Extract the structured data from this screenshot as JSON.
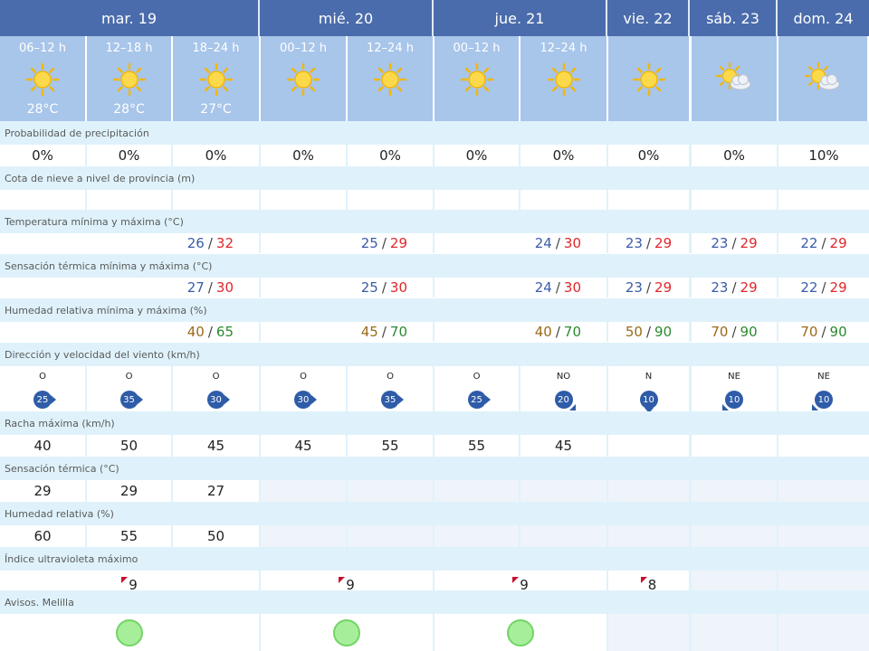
{
  "days": [
    {
      "label": "mar. 19"
    },
    {
      "label": "mié. 20"
    },
    {
      "label": "jue. 21"
    },
    {
      "label": "vie. 22"
    },
    {
      "label": "sáb. 23"
    },
    {
      "label": "dom. 24"
    }
  ],
  "periods": [
    {
      "label": "06–12 h",
      "temp": "28°C",
      "icon": "sun-icon"
    },
    {
      "label": "12–18 h",
      "temp": "28°C",
      "icon": "sun-icon"
    },
    {
      "label": "18–24 h",
      "temp": "27°C",
      "icon": "sun-icon"
    },
    {
      "label": "00–12 h",
      "temp": "",
      "icon": "sun-icon"
    },
    {
      "label": "12–24 h",
      "temp": "",
      "icon": "sun-icon"
    },
    {
      "label": "00–12 h",
      "temp": "",
      "icon": "sun-icon"
    },
    {
      "label": "12–24 h",
      "temp": "",
      "icon": "sun-icon"
    },
    {
      "label": "",
      "temp": "",
      "icon": "sun-icon"
    },
    {
      "label": "",
      "temp": "",
      "icon": "sun-cloud-icon"
    },
    {
      "label": "",
      "temp": "",
      "icon": "sun-cloud-icon"
    }
  ],
  "labels": {
    "precip": "Probabilidad de precipitación",
    "snow": "Cota de nieve a nivel de provincia (m)",
    "temp": "Temperatura mínima y máxima (°C)",
    "feels": "Sensación térmica mínima y máxima (°C)",
    "humidity": "Humedad relativa mínima y máxima (%)",
    "wind": "Dirección y velocidad del viento (km/h)",
    "gust": "Racha máxima (km/h)",
    "feels_now": "Sensación térmica (°C)",
    "humidity_now": "Humedad relativa (%)",
    "uv": "Índice ultravioleta máximo",
    "warnings": "Avisos. Melilla"
  },
  "precip": [
    "0%",
    "0%",
    "0%",
    "0%",
    "0%",
    "0%",
    "0%",
    "0%",
    "0%",
    "10%"
  ],
  "temp_range": [
    {
      "min": "26",
      "max": "32"
    },
    {
      "min": "25",
      "max": "29"
    },
    {
      "min": "24",
      "max": "30"
    },
    {
      "min": "23",
      "max": "29"
    },
    {
      "min": "23",
      "max": "29"
    },
    {
      "min": "22",
      "max": "29"
    }
  ],
  "feels_range": [
    {
      "min": "27",
      "max": "30"
    },
    {
      "min": "25",
      "max": "30"
    },
    {
      "min": "24",
      "max": "30"
    },
    {
      "min": "23",
      "max": "29"
    },
    {
      "min": "23",
      "max": "29"
    },
    {
      "min": "22",
      "max": "29"
    }
  ],
  "humidity_range": [
    {
      "min": "40",
      "max": "65"
    },
    {
      "min": "45",
      "max": "70"
    },
    {
      "min": "40",
      "max": "70"
    },
    {
      "min": "50",
      "max": "90"
    },
    {
      "min": "70",
      "max": "90"
    },
    {
      "min": "70",
      "max": "90"
    }
  ],
  "wind": [
    {
      "dir": "O",
      "speed": "25"
    },
    {
      "dir": "O",
      "speed": "35"
    },
    {
      "dir": "O",
      "speed": "30"
    },
    {
      "dir": "O",
      "speed": "30"
    },
    {
      "dir": "O",
      "speed": "35"
    },
    {
      "dir": "O",
      "speed": "25"
    },
    {
      "dir": "NO",
      "speed": "20"
    },
    {
      "dir": "N",
      "speed": "10"
    },
    {
      "dir": "NE",
      "speed": "10"
    },
    {
      "dir": "NE",
      "speed": "10"
    }
  ],
  "gust": [
    "40",
    "50",
    "45",
    "45",
    "55",
    "55",
    "45",
    "",
    "",
    ""
  ],
  "feels_now": [
    "29",
    "29",
    "27"
  ],
  "humidity_now": [
    "60",
    "55",
    "50"
  ],
  "uv": [
    "9",
    "9",
    "9",
    "8"
  ],
  "colors": {
    "header": "#4a6cac",
    "period": "#a8c5ea",
    "section": "#dff2fb",
    "temp_min": "#3a5ca8",
    "temp_max": "#e1262b",
    "hum_min": "#9a6a1a",
    "hum_max": "#2b8a2e",
    "wind_badge": "#2f5ca8",
    "warning_green": "#a7ee9a"
  }
}
